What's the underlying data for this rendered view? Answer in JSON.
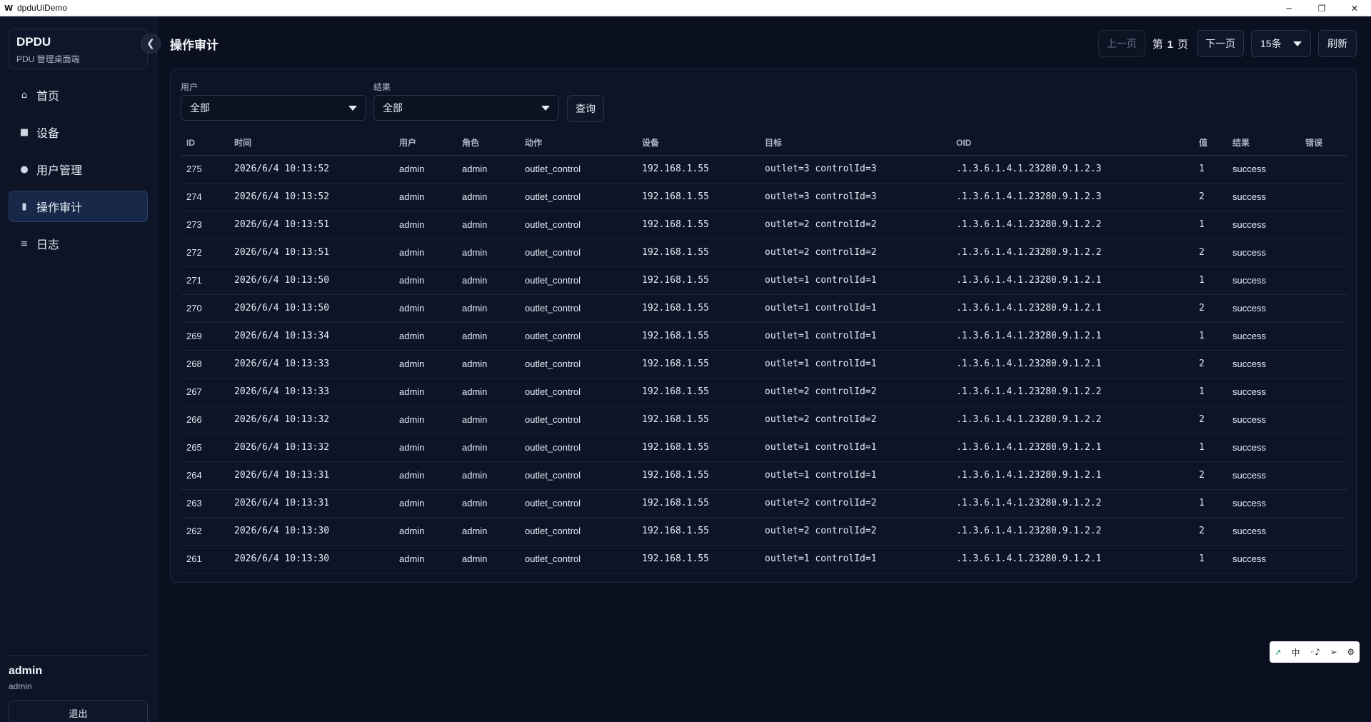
{
  "window": {
    "app_icon": "W",
    "title": "dpduUiDemo",
    "minimize": "─",
    "restore": "❐",
    "close": "✕"
  },
  "sidebar": {
    "brand_name": "DPDU",
    "brand_sub": "PDU 管理桌面端",
    "collapse_icon": "❮",
    "items": [
      {
        "label": "首页",
        "icon": "⌂"
      },
      {
        "label": "设备",
        "icon": "■"
      },
      {
        "label": "用户管理",
        "icon": "●"
      },
      {
        "label": "操作审计",
        "icon": "▮"
      },
      {
        "label": "日志",
        "icon": "≡"
      }
    ],
    "active_index": 3,
    "user_name": "admin",
    "user_role": "admin",
    "logout_label": "退出"
  },
  "header": {
    "title": "操作审计",
    "prev_label": "上一页",
    "page_prefix": "第",
    "page_number": "1",
    "page_suffix": "页",
    "next_label": "下一页",
    "page_size": "15条",
    "refresh_label": "刷新"
  },
  "filters": {
    "user_label": "用户",
    "user_value": "全部",
    "result_label": "结果",
    "result_value": "全部",
    "query_label": "查询"
  },
  "table": {
    "columns": [
      "ID",
      "时间",
      "用户",
      "角色",
      "动作",
      "设备",
      "目标",
      "OID",
      "值",
      "结果",
      "错误"
    ],
    "rows": [
      [
        "275",
        "2026/6/4 10:13:52",
        "admin",
        "admin",
        "outlet_control",
        "192.168.1.55",
        "outlet=3 controlId=3",
        ".1.3.6.1.4.1.23280.9.1.2.3",
        "1",
        "success",
        ""
      ],
      [
        "274",
        "2026/6/4 10:13:52",
        "admin",
        "admin",
        "outlet_control",
        "192.168.1.55",
        "outlet=3 controlId=3",
        ".1.3.6.1.4.1.23280.9.1.2.3",
        "2",
        "success",
        ""
      ],
      [
        "273",
        "2026/6/4 10:13:51",
        "admin",
        "admin",
        "outlet_control",
        "192.168.1.55",
        "outlet=2 controlId=2",
        ".1.3.6.1.4.1.23280.9.1.2.2",
        "1",
        "success",
        ""
      ],
      [
        "272",
        "2026/6/4 10:13:51",
        "admin",
        "admin",
        "outlet_control",
        "192.168.1.55",
        "outlet=2 controlId=2",
        ".1.3.6.1.4.1.23280.9.1.2.2",
        "2",
        "success",
        ""
      ],
      [
        "271",
        "2026/6/4 10:13:50",
        "admin",
        "admin",
        "outlet_control",
        "192.168.1.55",
        "outlet=1 controlId=1",
        ".1.3.6.1.4.1.23280.9.1.2.1",
        "1",
        "success",
        ""
      ],
      [
        "270",
        "2026/6/4 10:13:50",
        "admin",
        "admin",
        "outlet_control",
        "192.168.1.55",
        "outlet=1 controlId=1",
        ".1.3.6.1.4.1.23280.9.1.2.1",
        "2",
        "success",
        ""
      ],
      [
        "269",
        "2026/6/4 10:13:34",
        "admin",
        "admin",
        "outlet_control",
        "192.168.1.55",
        "outlet=1 controlId=1",
        ".1.3.6.1.4.1.23280.9.1.2.1",
        "1",
        "success",
        ""
      ],
      [
        "268",
        "2026/6/4 10:13:33",
        "admin",
        "admin",
        "outlet_control",
        "192.168.1.55",
        "outlet=1 controlId=1",
        ".1.3.6.1.4.1.23280.9.1.2.1",
        "2",
        "success",
        ""
      ],
      [
        "267",
        "2026/6/4 10:13:33",
        "admin",
        "admin",
        "outlet_control",
        "192.168.1.55",
        "outlet=2 controlId=2",
        ".1.3.6.1.4.1.23280.9.1.2.2",
        "1",
        "success",
        ""
      ],
      [
        "266",
        "2026/6/4 10:13:32",
        "admin",
        "admin",
        "outlet_control",
        "192.168.1.55",
        "outlet=2 controlId=2",
        ".1.3.6.1.4.1.23280.9.1.2.2",
        "2",
        "success",
        ""
      ],
      [
        "265",
        "2026/6/4 10:13:32",
        "admin",
        "admin",
        "outlet_control",
        "192.168.1.55",
        "outlet=1 controlId=1",
        ".1.3.6.1.4.1.23280.9.1.2.1",
        "1",
        "success",
        ""
      ],
      [
        "264",
        "2026/6/4 10:13:31",
        "admin",
        "admin",
        "outlet_control",
        "192.168.1.55",
        "outlet=1 controlId=1",
        ".1.3.6.1.4.1.23280.9.1.2.1",
        "2",
        "success",
        ""
      ],
      [
        "263",
        "2026/6/4 10:13:31",
        "admin",
        "admin",
        "outlet_control",
        "192.168.1.55",
        "outlet=2 controlId=2",
        ".1.3.6.1.4.1.23280.9.1.2.2",
        "1",
        "success",
        ""
      ],
      [
        "262",
        "2026/6/4 10:13:30",
        "admin",
        "admin",
        "outlet_control",
        "192.168.1.55",
        "outlet=2 controlId=2",
        ".1.3.6.1.4.1.23280.9.1.2.2",
        "2",
        "success",
        ""
      ],
      [
        "261",
        "2026/6/4 10:13:30",
        "admin",
        "admin",
        "outlet_control",
        "192.168.1.55",
        "outlet=1 controlId=1",
        ".1.3.6.1.4.1.23280.9.1.2.1",
        "1",
        "success",
        ""
      ]
    ]
  },
  "ime": {
    "logo": "➚",
    "lang": "中",
    "punct": "◦♪",
    "send": "➢",
    "settings": "⚙"
  }
}
